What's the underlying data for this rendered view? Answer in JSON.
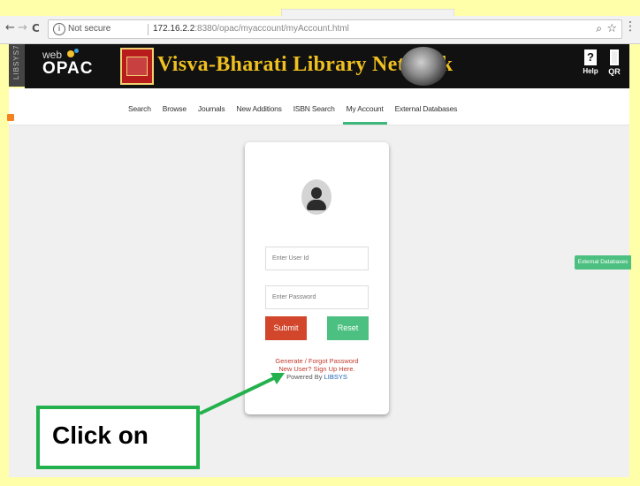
{
  "browser": {
    "back": "←",
    "forward": "→",
    "reload": "C",
    "security_label": "Not secure",
    "url_host": "172.16.2.2",
    "url_rest": ":8380/opac/myaccount/myAccount.html",
    "zoom_icon": "search-icon",
    "star_icon": "star-icon",
    "menu_icon": "⋮"
  },
  "side_strip": {
    "label": "LIBSYS7"
  },
  "banner": {
    "logo_web": "web",
    "logo_opac": "OPAC",
    "title": "Visva-Bharati Library Network",
    "help_label": "Help",
    "help_glyph": "?",
    "qr_label": "QR"
  },
  "nav": {
    "items": [
      {
        "label": "Search"
      },
      {
        "label": "Browse"
      },
      {
        "label": "Journals"
      },
      {
        "label": "New Additions"
      },
      {
        "label": "ISBN Search"
      },
      {
        "label": "My Account",
        "active": true
      },
      {
        "label": "External Databases"
      }
    ]
  },
  "login": {
    "user_placeholder": "Enter User Id",
    "password_placeholder": "Enter Password",
    "submit_label": "Submit",
    "reset_label": "Reset",
    "generate_link": "Generate / Forgot Password",
    "signup_link": "New User? Sign Up Here.",
    "powered_by": "Powered By",
    "powered_brand": "LIBSYS"
  },
  "side_tab": {
    "label": "External Databases"
  },
  "annotation": {
    "text": "Click on"
  },
  "colors": {
    "background": "#ffffaa",
    "accent_green": "#4cc080",
    "submit_red": "#d2462c",
    "banner_title": "#f0c020",
    "annotation_border": "#22b14c"
  }
}
